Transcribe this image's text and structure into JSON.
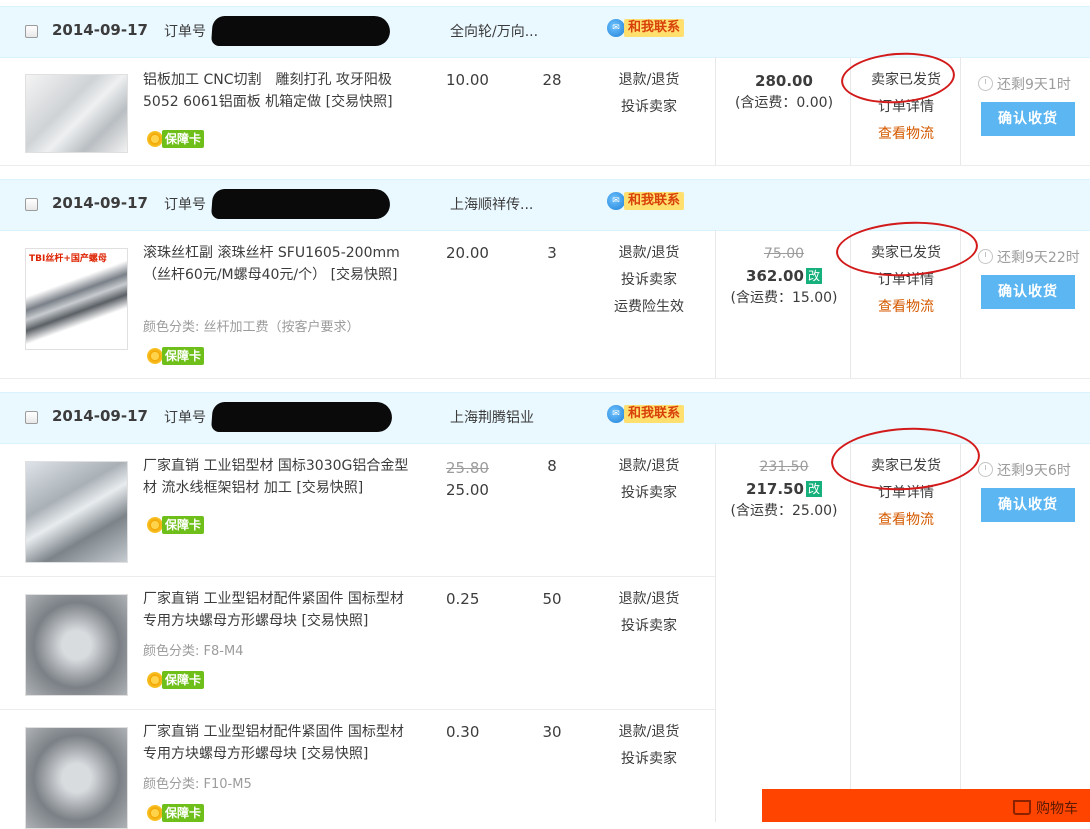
{
  "orders": [
    {
      "date": "2014-09-17",
      "order_no_label": "订单号",
      "shop": "全向轮/万向...",
      "contact_label": "和我联系",
      "items": [
        {
          "title": "铝板加工 CNC切割　雕刻打孔 攻牙阳极5052 6061铝面板 机箱定做 [交易快照]",
          "sku": "",
          "badge": "保障卡",
          "price": "10.00",
          "old_price": "",
          "qty": "28",
          "ops": [
            "退款/退货",
            "投诉卖家"
          ]
        }
      ],
      "total_old": "",
      "total": "280.00",
      "total_modified": "",
      "shipping": "(含运费：0.00)",
      "status": [
        "卖家已发货",
        "订单详情",
        "查看物流"
      ],
      "remaining": "还剩9天1时",
      "confirm": "确认收货"
    },
    {
      "date": "2014-09-17",
      "order_no_label": "订单号",
      "shop": "上海顺祥传...",
      "contact_label": "和我联系",
      "items": [
        {
          "title": "滚珠丝杠副 滚珠丝杆 SFU1605-200mm（丝杆60元/M螺母40元/个） [交易快照]",
          "sku": "颜色分类: 丝杆加工费（按客户要求）",
          "badge": "保障卡",
          "price": "20.00",
          "old_price": "",
          "qty": "3",
          "ops": [
            "退款/退货",
            "投诉卖家",
            "运费险生效"
          ],
          "thumb_text": "TBI丝杆+国产螺母"
        }
      ],
      "total_old": "75.00",
      "total": "362.00",
      "total_modified": "改",
      "shipping": "(含运费：15.00)",
      "status": [
        "卖家已发货",
        "订单详情",
        "查看物流"
      ],
      "remaining": "还剩9天22时",
      "confirm": "确认收货"
    },
    {
      "date": "2014-09-17",
      "order_no_label": "订单号",
      "shop": "上海荆腾铝业",
      "contact_label": "和我联系",
      "items": [
        {
          "title": "厂家直销 工业铝型材 国标3030G铝合金型材 流水线框架铝材 加工 [交易快照]",
          "sku": "",
          "badge": "保障卡",
          "price": "25.00",
          "old_price": "25.80",
          "qty": "8",
          "ops": [
            "退款/退货",
            "投诉卖家"
          ]
        },
        {
          "title": "厂家直销 工业型铝材配件紧固件 国标型材专用方块螺母方形螺母块 [交易快照]",
          "sku": "颜色分类: F8-M4",
          "badge": "保障卡",
          "price": "0.25",
          "old_price": "",
          "qty": "50",
          "ops": [
            "退款/退货",
            "投诉卖家"
          ]
        },
        {
          "title": "厂家直销 工业型铝材配件紧固件 国标型材专用方块螺母方形螺母块 [交易快照]",
          "sku": "颜色分类: F10-M5",
          "badge": "保障卡",
          "price": "0.30",
          "old_price": "",
          "qty": "30",
          "ops": [
            "退款/退货",
            "投诉卖家"
          ]
        }
      ],
      "total_old": "231.50",
      "total": "217.50",
      "total_modified": "改",
      "shipping": "(含运费：25.00)",
      "status": [
        "卖家已发货",
        "订单详情",
        "查看物流"
      ],
      "remaining": "还剩9天6时",
      "confirm": "确认收货"
    }
  ],
  "cart": {
    "label": "购物车"
  }
}
